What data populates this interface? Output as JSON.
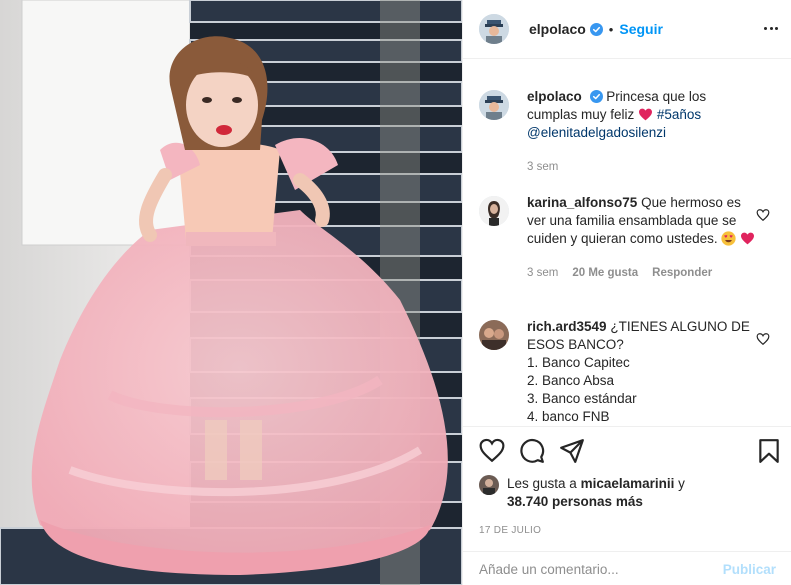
{
  "post": {
    "username": "elpolaco",
    "follow_label": "Seguir",
    "dot": "•"
  },
  "caption": {
    "username": "elpolaco",
    "text": "Princesa que los cumplas muy feliz",
    "hashtag": "#5años",
    "mention": "@elenitadelgadosilenzi",
    "time": "3 sem"
  },
  "comments": [
    {
      "username": "karina_alfonso75",
      "text": "Que hermoso es ver una familia ensamblada que se cuiden y quieran como ustedes.",
      "time": "3 sem",
      "likes": "20 Me gusta",
      "reply": "Responder"
    },
    {
      "username": "rich.ard3549",
      "text": "¿TIENES ALGUNO DE ESOS BANCO?",
      "lines": [
        "1. Banco Capitec",
        "2. Banco Absa",
        "3. Banco estándar",
        "4. banco FNB"
      ]
    }
  ],
  "likes": {
    "prefix": "Les gusta a",
    "user": "micaelamarinii",
    "joiner": "y",
    "count": "38.740 personas más"
  },
  "date": "17 DE JULIO",
  "add_comment": {
    "placeholder": "Añade un comentario...",
    "publish": "Publicar"
  },
  "colors": {
    "link": "#0095f6",
    "like_red": "#ed4956",
    "muted": "#8e8e8e"
  },
  "icons": [
    "verified-badge-icon",
    "more-options-icon",
    "heart-icon",
    "comment-icon",
    "share-icon",
    "bookmark-icon"
  ]
}
